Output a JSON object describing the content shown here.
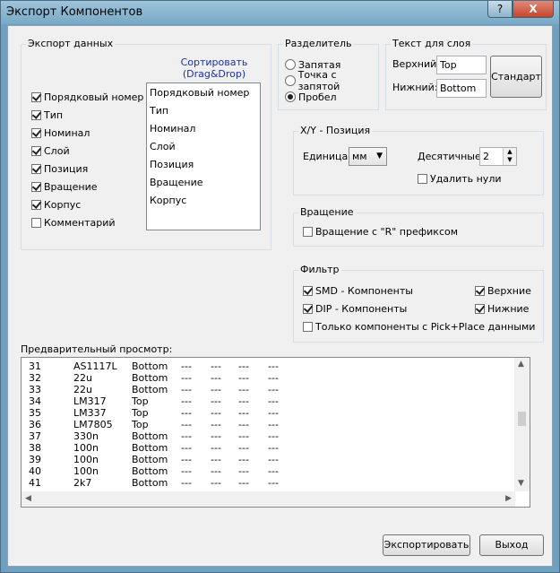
{
  "window": {
    "title": "Экспорт Компонентов",
    "help_label": "?",
    "close_label": "X"
  },
  "export": {
    "label": "Экспорт данных",
    "sort_title": "Сортировать (Drag&Drop)",
    "checks": [
      {
        "label": "Порядковый номер",
        "checked": true
      },
      {
        "label": "Тип",
        "checked": true
      },
      {
        "label": "Номинал",
        "checked": true
      },
      {
        "label": "Слой",
        "checked": true
      },
      {
        "label": "Позиция",
        "checked": true
      },
      {
        "label": "Вращение",
        "checked": true
      },
      {
        "label": "Корпус",
        "checked": true
      },
      {
        "label": "Комментарий",
        "checked": false
      }
    ],
    "sort_items": [
      "Порядковый номер",
      "Тип",
      "Номинал",
      "Слой",
      "Позиция",
      "Вращение",
      "Корпус"
    ]
  },
  "separator": {
    "label": "Разделитель",
    "options": [
      {
        "label": "Запятая",
        "selected": false
      },
      {
        "label": "Точка с запятой",
        "selected": false
      },
      {
        "label": "Пробел",
        "selected": true
      }
    ]
  },
  "layer_text": {
    "label": "Текст для слоя",
    "top_label": "Верхний:",
    "top_value": "Top",
    "bottom_label": "Нижний:",
    "bottom_value": "Bottom",
    "standard_label": "Стандарт"
  },
  "xy": {
    "label": "X/Y - Позиция",
    "unit_label": "Единица :",
    "unit_value": "мм",
    "decimals_label": "Десятичные:",
    "decimals_value": "2",
    "remove_zeros_label": "Удалить нули",
    "remove_zeros_checked": false
  },
  "rotation": {
    "label": "Вращение",
    "prefix_label": "Вращение с  \"R\" префиксом",
    "prefix_checked": false
  },
  "filter": {
    "label": "Фильтр",
    "smd_label": "SMD - Компоненты",
    "smd_checked": true,
    "dip_label": "DIP - Компоненты",
    "dip_checked": true,
    "top_label": "Верхние",
    "top_checked": true,
    "bottom_label": "Нижние",
    "bottom_checked": true,
    "pick_label": "Только компоненты с Pick+Place данными",
    "pick_checked": false
  },
  "preview": {
    "label": "Предварительный просмотр:",
    "rows": [
      [
        "31",
        "AS1117L",
        "Bottom",
        "---",
        "---",
        "---",
        "---"
      ],
      [
        "32",
        "22u",
        "Bottom",
        "---",
        "---",
        "---",
        "---"
      ],
      [
        "33",
        "22u",
        "Bottom",
        "---",
        "---",
        "---",
        "---"
      ],
      [
        "34",
        "LM317",
        "Top",
        "---",
        "---",
        "---",
        "---"
      ],
      [
        "35",
        "LM337",
        "Top",
        "---",
        "---",
        "---",
        "---"
      ],
      [
        "36",
        "LM7805",
        "Top",
        "---",
        "---",
        "---",
        "---"
      ],
      [
        "37",
        "330n",
        "Bottom",
        "---",
        "---",
        "---",
        "---"
      ],
      [
        "38",
        "100n",
        "Bottom",
        "---",
        "---",
        "---",
        "---"
      ],
      [
        "39",
        "100n",
        "Bottom",
        "---",
        "---",
        "---",
        "---"
      ],
      [
        "40",
        "100n",
        "Bottom",
        "---",
        "---",
        "---",
        "---"
      ],
      [
        "41",
        "2k7",
        "Bottom",
        "---",
        "---",
        "---",
        "---"
      ]
    ]
  },
  "buttons": {
    "export_label": "Экспортировать",
    "exit_label": "Выход"
  }
}
